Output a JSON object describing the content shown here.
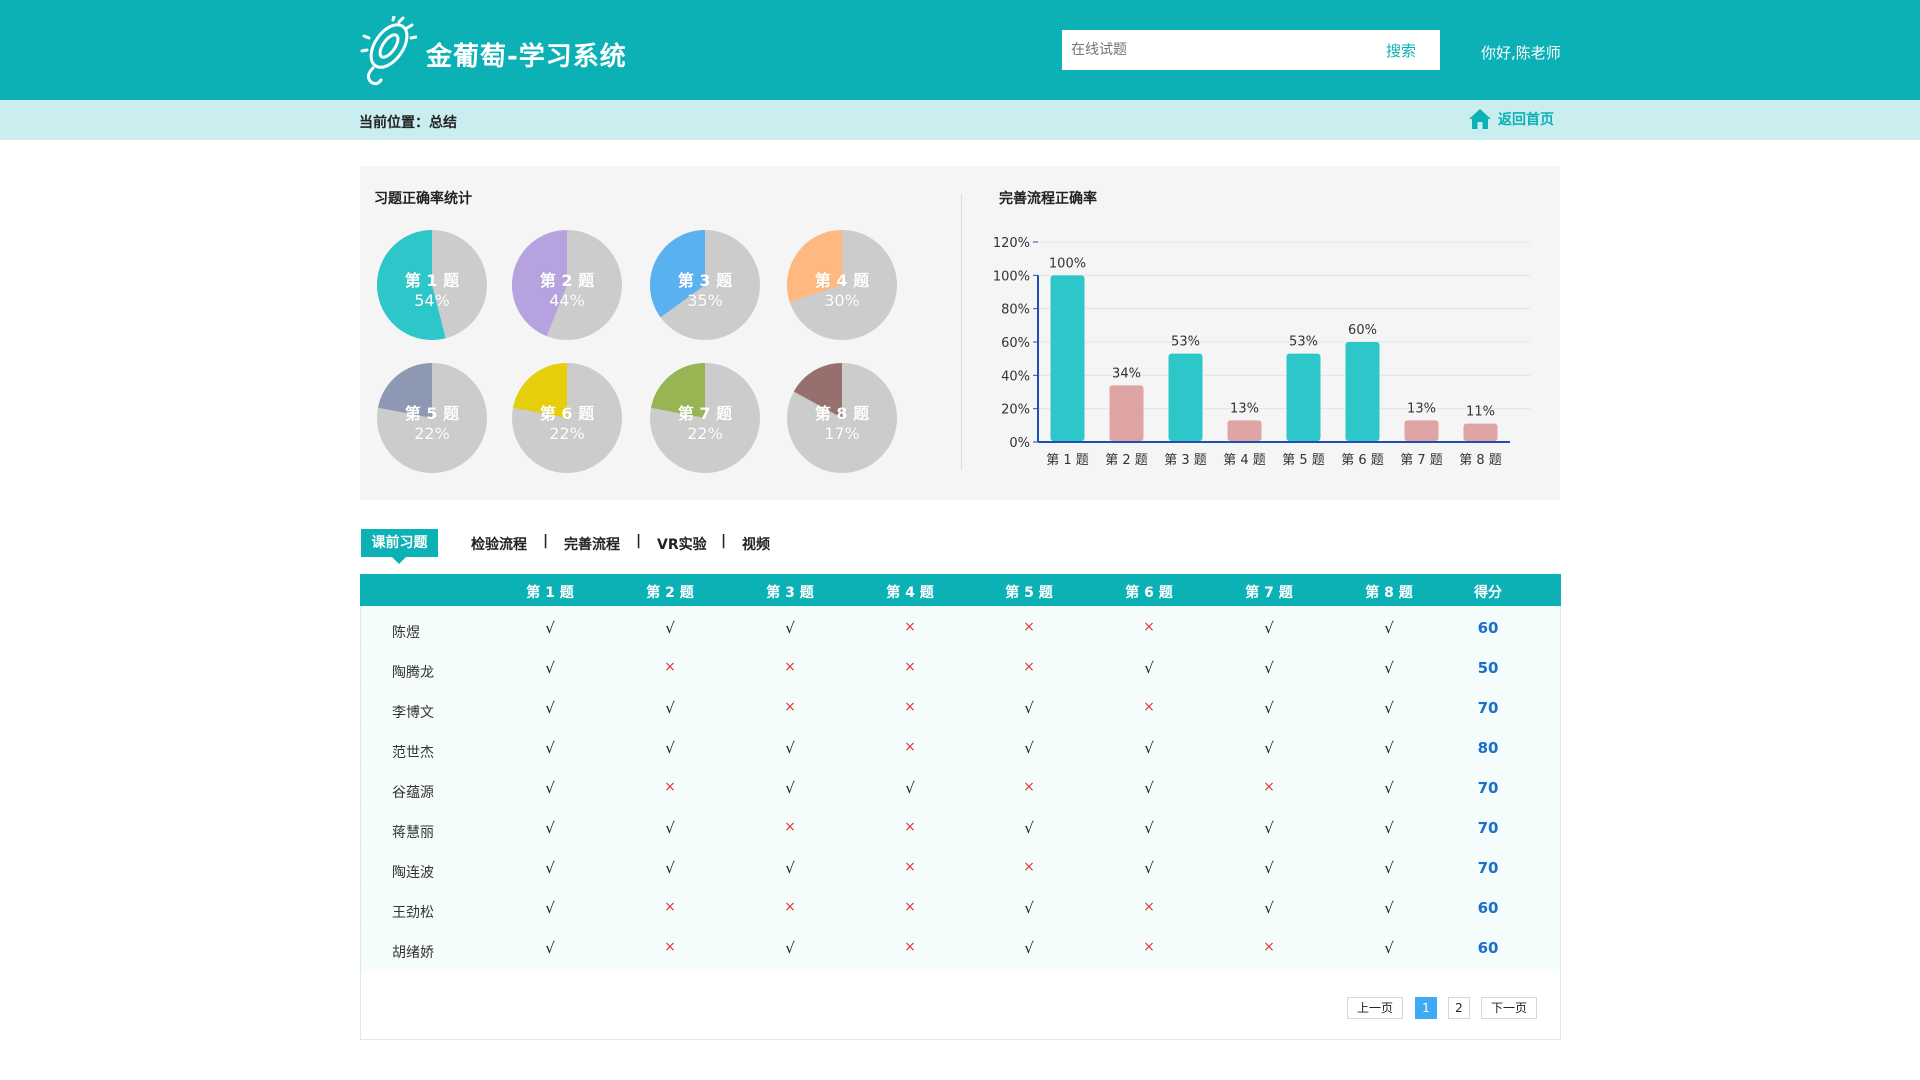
{
  "header": {
    "app_title": "金葡萄-学习系统",
    "search_placeholder": "在线试题",
    "search_button": "搜索",
    "greeting": "你好,陈老师"
  },
  "breadcrumb": {
    "text": "当前位置：总结",
    "home_link": "返回首页"
  },
  "stats": {
    "pie_title": "习题正确率统计",
    "bar_title": "完善流程正确率",
    "pies": [
      {
        "label": "第 1 题",
        "value": "54%",
        "percent": 54,
        "color": "#2ec7c9"
      },
      {
        "label": "第 2 题",
        "value": "44%",
        "percent": 44,
        "color": "#b6a2de"
      },
      {
        "label": "第 3 题",
        "value": "35%",
        "percent": 35,
        "color": "#5ab1ef"
      },
      {
        "label": "第 4 题",
        "value": "30%",
        "percent": 30,
        "color": "#ffb980"
      },
      {
        "label": "第 5 题",
        "value": "22%",
        "percent": 22,
        "color": "#8d98b3"
      },
      {
        "label": "第 6 题",
        "value": "22%",
        "percent": 22,
        "color": "#e5cf0d"
      },
      {
        "label": "第 7 题",
        "value": "22%",
        "percent": 22,
        "color": "#97b552"
      },
      {
        "label": "第 8 题",
        "value": "17%",
        "percent": 17,
        "color": "#95706d"
      }
    ]
  },
  "chart_data": {
    "type": "bar",
    "title": "完善流程正确率",
    "categories": [
      "第 1 题",
      "第 2 题",
      "第 3 题",
      "第 4 题",
      "第 5 题",
      "第 6 题",
      "第 7 题",
      "第 8 题"
    ],
    "values": [
      100,
      34,
      53,
      13,
      53,
      60,
      13,
      11
    ],
    "value_labels": [
      "100%",
      "34%",
      "53%",
      "13%",
      "53%",
      "60%",
      "13%",
      "11%"
    ],
    "ylim": [
      0,
      120
    ],
    "yticks": [
      "0%",
      "20%",
      "40%",
      "60%",
      "80%",
      "100%",
      "120%"
    ],
    "bar_colors": [
      "#2ec7c9",
      "#dea3a3",
      "#2ec7c9",
      "#dea3a3",
      "#2ec7c9",
      "#2ec7c9",
      "#dea3a3",
      "#dea3a3"
    ],
    "grid": true,
    "xlabel": "",
    "ylabel": ""
  },
  "tabs": {
    "active": "课前习题",
    "items": [
      "检验流程",
      "完善流程",
      "VR实验",
      "视频"
    ],
    "separator": "|"
  },
  "table": {
    "headers": [
      "第 1 题",
      "第 2 题",
      "第 3 题",
      "第 4 题",
      "第 5 题",
      "第 6 题",
      "第 7 题",
      "第 8 题",
      "得分"
    ],
    "rows": [
      {
        "name": "陈煜",
        "marks": [
          "√",
          "√",
          "√",
          "×",
          "×",
          "×",
          "√",
          "√"
        ],
        "score": "60"
      },
      {
        "name": "陶腾龙",
        "marks": [
          "√",
          "×",
          "×",
          "×",
          "×",
          "√",
          "√",
          "√"
        ],
        "score": "50"
      },
      {
        "name": "李博文",
        "marks": [
          "√",
          "√",
          "×",
          "×",
          "√",
          "×",
          "√",
          "√"
        ],
        "score": "70"
      },
      {
        "name": "范世杰",
        "marks": [
          "√",
          "√",
          "√",
          "×",
          "√",
          "√",
          "√",
          "√"
        ],
        "score": "80"
      },
      {
        "name": "谷蕴源",
        "marks": [
          "√",
          "×",
          "√",
          "√",
          "×",
          "√",
          "×",
          "√"
        ],
        "score": "70"
      },
      {
        "name": "蒋慧丽",
        "marks": [
          "√",
          "√",
          "×",
          "×",
          "√",
          "√",
          "√",
          "√"
        ],
        "score": "70"
      },
      {
        "name": "陶连波",
        "marks": [
          "√",
          "√",
          "√",
          "×",
          "×",
          "√",
          "√",
          "√"
        ],
        "score": "70"
      },
      {
        "name": "王劲松",
        "marks": [
          "√",
          "×",
          "×",
          "×",
          "√",
          "×",
          "√",
          "√"
        ],
        "score": "60"
      },
      {
        "name": "胡绪娇",
        "marks": [
          "√",
          "×",
          "√",
          "×",
          "√",
          "×",
          "×",
          "√"
        ],
        "score": "60"
      }
    ]
  },
  "pager": {
    "prev": "上一页",
    "pages": [
      "1",
      "2"
    ],
    "current": "1",
    "next": "下一页"
  },
  "colors": {
    "brand": "#0cb1b5",
    "breadcrumb_bg": "#caeef0",
    "score": "#1c6fc9",
    "wrong": "#e03a3a",
    "pie_rest": "#cccccc"
  }
}
